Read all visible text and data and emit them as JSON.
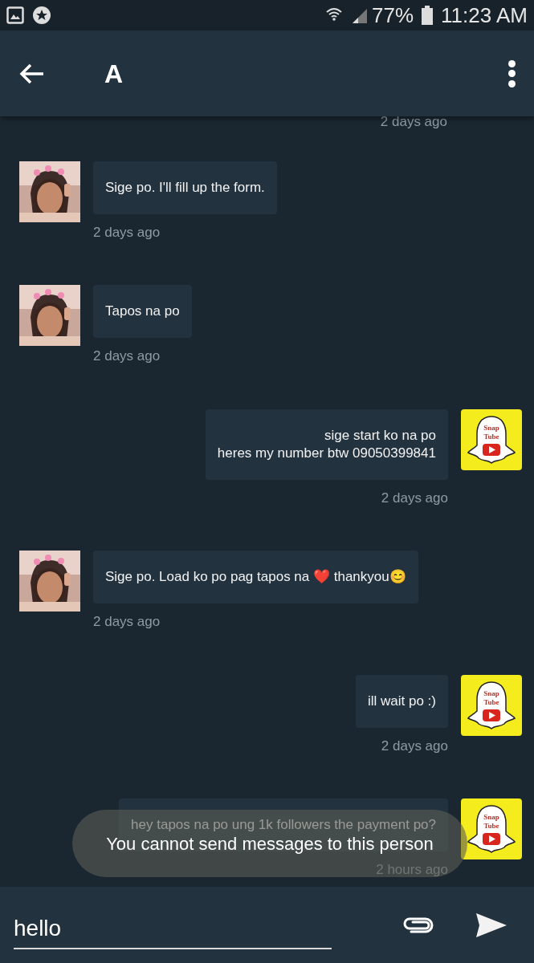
{
  "status_bar": {
    "battery": "77%",
    "time": "11:23 AM"
  },
  "header": {
    "title": "A"
  },
  "top_time": "2 days ago",
  "messages": [
    {
      "kind": "incoming",
      "lines": [
        "Sige po. I'll fill up the form."
      ],
      "time": "2 days ago"
    },
    {
      "kind": "incoming",
      "lines": [
        "Tapos na po"
      ],
      "time": "2 days ago"
    },
    {
      "kind": "outgoing",
      "lines": [
        "sige start ko na po",
        "heres my number btw 09050399841"
      ],
      "time": "2 days ago",
      "logo": [
        "Snap",
        "Tube"
      ]
    },
    {
      "kind": "incoming",
      "lines": [
        "Sige po. Load ko po pag tapos na ❤️ thankyou😊"
      ],
      "time": "2 days ago"
    },
    {
      "kind": "outgoing",
      "lines": [
        "ill wait po :)"
      ],
      "time": "2 days ago",
      "logo": [
        "Snap",
        "Tube"
      ]
    },
    {
      "kind": "outgoing",
      "lines": [
        "hey tapos na po ung 1k followers the payment po?"
      ],
      "time": "2 hours ago",
      "logo": [
        "Snap",
        "Tube"
      ]
    }
  ],
  "toast": "You cannot send messages to this person",
  "composer": {
    "value": "hello"
  }
}
